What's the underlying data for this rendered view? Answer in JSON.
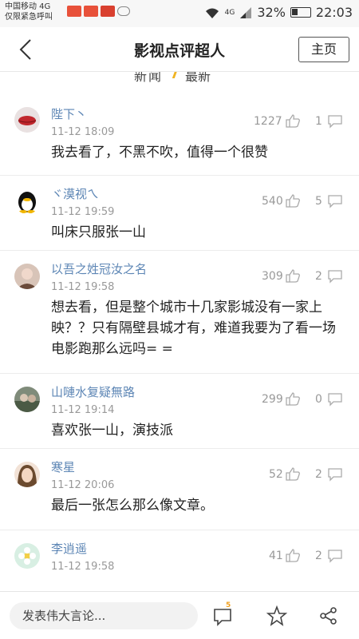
{
  "status_bar": {
    "carrier": "中国移动 4G",
    "emergency": "仅限紧急呼叫",
    "network": "4G",
    "battery": "32%",
    "time": "22:03"
  },
  "header": {
    "title": "影视点评超人",
    "home_label": "主页"
  },
  "comments": [
    {
      "user": "陛下丶",
      "time": "11-12 18:09",
      "text": "我去看了，不黑不吹，值得一个很赞",
      "likes": "1227",
      "replies": "1"
    },
    {
      "user": "ヾ漠视ㄟ",
      "time": "11-12 19:59",
      "text": "叫床只服张一山",
      "likes": "540",
      "replies": "5"
    },
    {
      "user": "以吾之姓冠汝之名",
      "time": "11-12 19:58",
      "text": "想去看，但是整个城市十几家影城没有一家上映？？只有隔壁县城才有，难道我要为了看一场电影跑那么远吗= =",
      "likes": "309",
      "replies": "2"
    },
    {
      "user": "山嗹水复疑無路",
      "time": "11-12 19:14",
      "text": "喜欢张一山，演技派",
      "likes": "299",
      "replies": "0"
    },
    {
      "user": "寒星",
      "time": "11-12 20:06",
      "text": "最后一张怎么那么像文章。",
      "likes": "52",
      "replies": "2"
    },
    {
      "user": "李逍遥",
      "time": "11-12 19:58",
      "text": "",
      "likes": "41",
      "replies": "2"
    }
  ],
  "bottom_bar": {
    "input_placeholder": "发表伟大言论...",
    "comment_count_badge": "5"
  }
}
